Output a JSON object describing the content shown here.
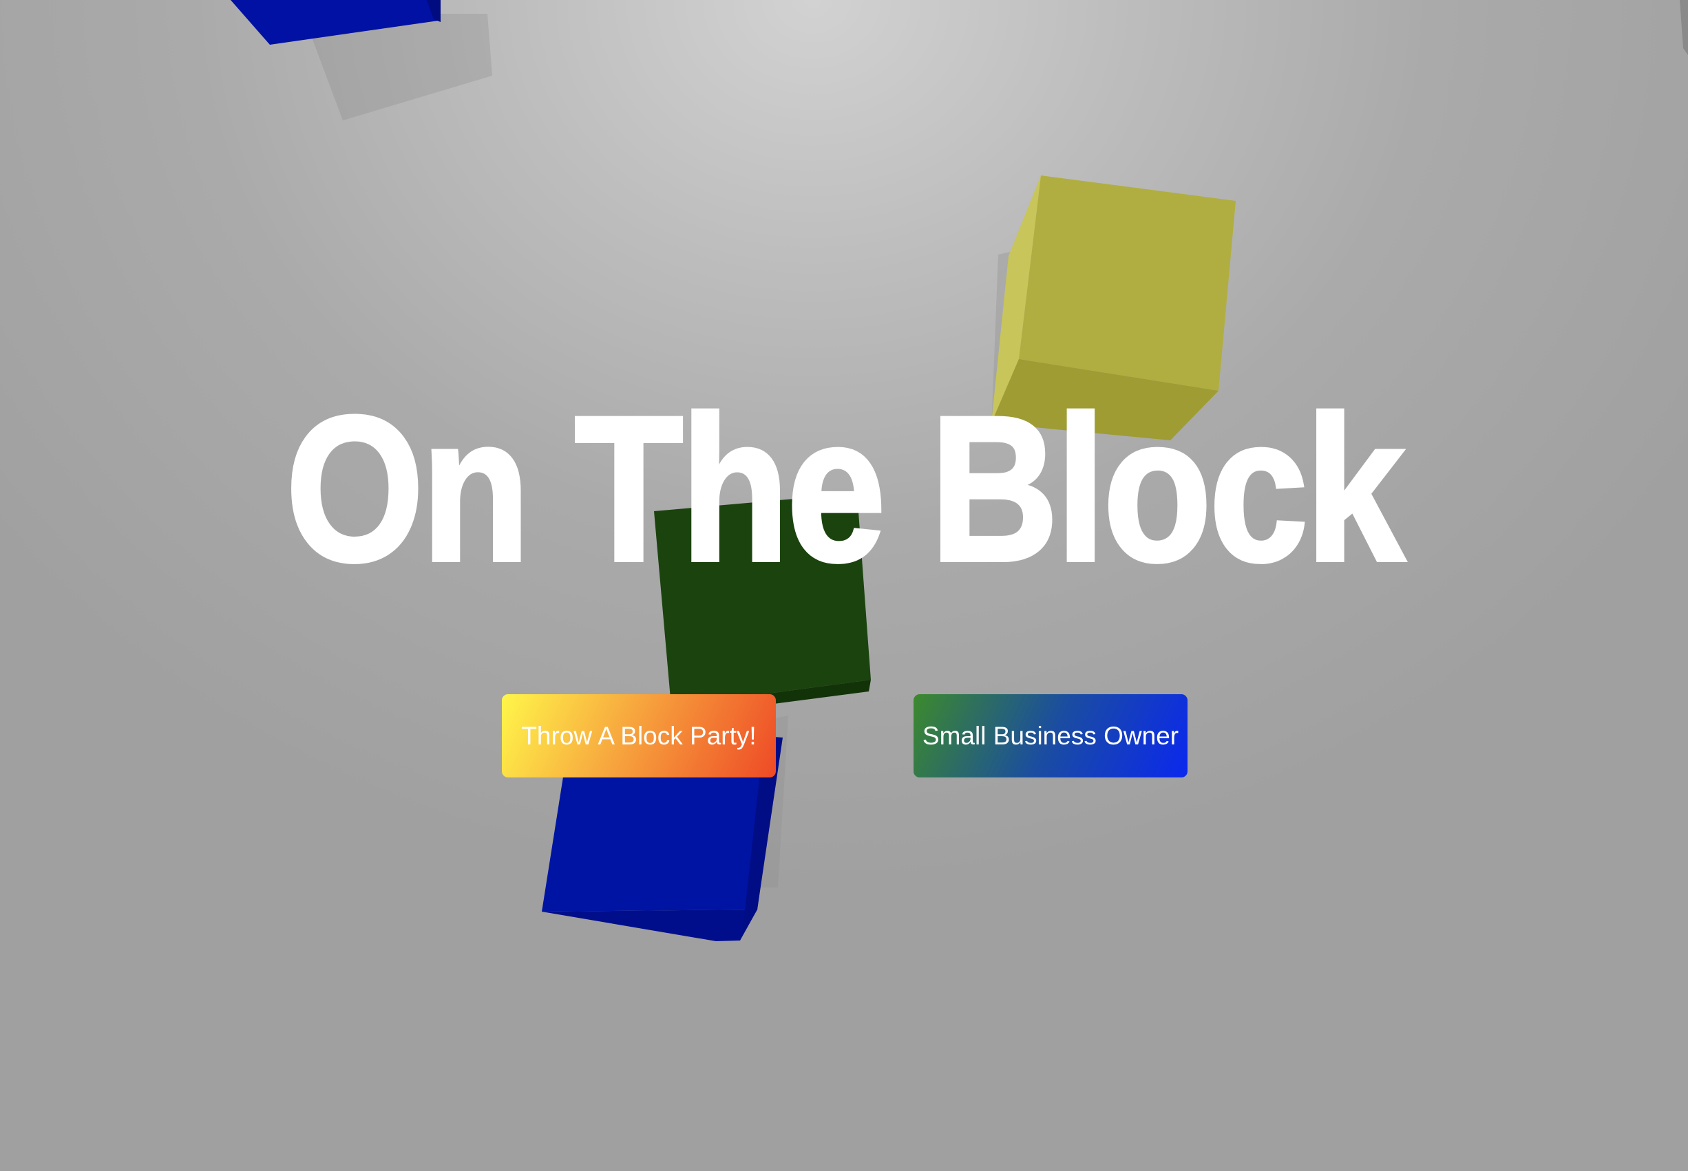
{
  "hero": {
    "title": "On The Block"
  },
  "actions": {
    "party_label": "Throw A Block Party!",
    "business_label": "Small Business Owner"
  },
  "colors": {
    "background": "#a6a6a6",
    "title_text": "#ffffff",
    "cube_blue": "#0010a3",
    "cube_yellow": "#b0ae40",
    "cube_green": "#1b430e"
  },
  "scene": {
    "cubes": [
      "blue-cube",
      "yellow-cube",
      "green-cube",
      "blue-cube"
    ]
  }
}
